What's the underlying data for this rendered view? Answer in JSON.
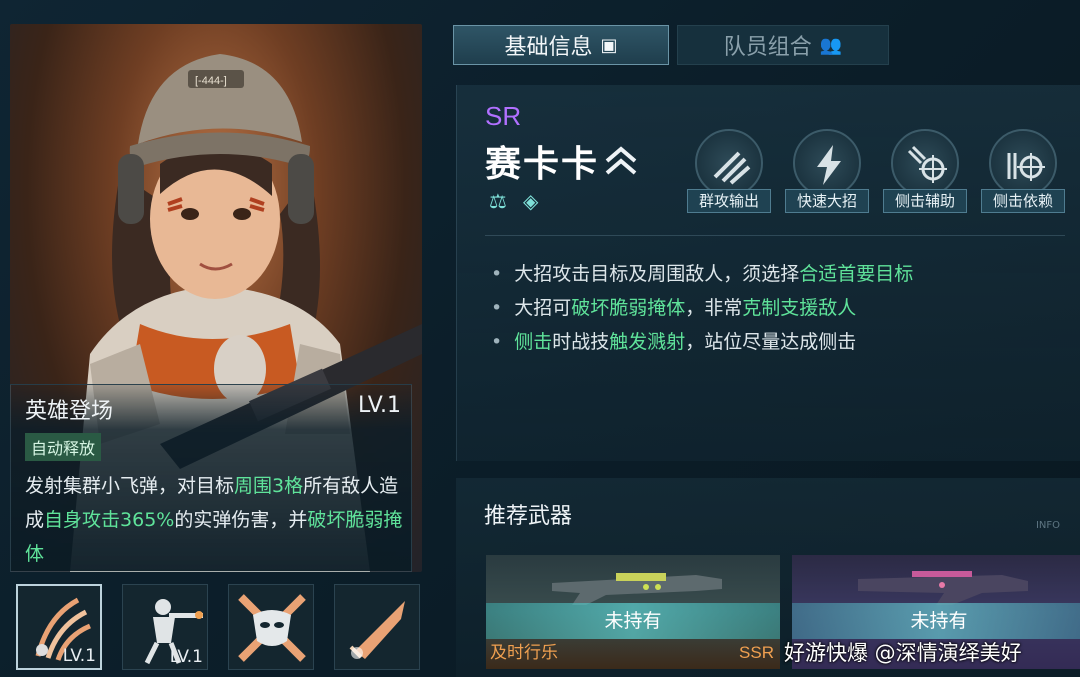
{
  "tabs": [
    {
      "label": "基础信息",
      "icon": "hero-card-icon",
      "active": true
    },
    {
      "label": "队员组合",
      "icon": "team-icon",
      "active": false
    }
  ],
  "hero": {
    "rarity": "SR",
    "name": "赛卡卡",
    "class_icons": [
      "balance-icon",
      "gem-icon"
    ],
    "traits": [
      {
        "label": "群攻输出",
        "icon": "missiles-icon"
      },
      {
        "label": "快速大招",
        "icon": "lightning-icon"
      },
      {
        "label": "侧击辅助",
        "icon": "flank-support-icon"
      },
      {
        "label": "侧击依赖",
        "icon": "flank-reliance-icon"
      }
    ],
    "tips": [
      [
        {
          "t": "大招攻击目标及周围敌人，须选择"
        },
        {
          "t": "合适首要目标",
          "hl": true
        }
      ],
      [
        {
          "t": "大招可"
        },
        {
          "t": "破坏脆弱掩体",
          "hl": true
        },
        {
          "t": "，非常"
        },
        {
          "t": "克制支援敌人",
          "hl": true
        }
      ],
      [
        {
          "t": "侧击",
          "hl": true
        },
        {
          "t": "时战技"
        },
        {
          "t": "触发溅射",
          "hl": true
        },
        {
          "t": "，站位尽量达成侧击"
        }
      ]
    ]
  },
  "skill": {
    "name": "英雄登场",
    "level": "LV.1",
    "tag": "自动释放",
    "desc": [
      {
        "t": "发射集群小飞弹，对目标"
      },
      {
        "t": "周围3格",
        "hl": true
      },
      {
        "t": "所有敌人造成"
      },
      {
        "t": "自身攻击365%",
        "hl": true
      },
      {
        "t": "的实弹伤害，并"
      },
      {
        "t": "破坏脆弱掩体",
        "hl": true
      }
    ]
  },
  "skill_icons": [
    {
      "icon": "missile-claw-icon",
      "level": "LV.1",
      "active": true
    },
    {
      "icon": "soldier-aim-icon",
      "level": "LV.1",
      "active": false
    },
    {
      "icon": "mask-cross-icon",
      "level": "",
      "active": false
    },
    {
      "icon": "bullet-icon",
      "level": "",
      "active": false
    }
  ],
  "weapons": {
    "title": "推荐武器",
    "info_label": "INFO",
    "items": [
      {
        "status": "未持有",
        "name": "及时行乐",
        "rarity": "SSR"
      },
      {
        "status": "未持有",
        "name": "",
        "rarity": ""
      }
    ]
  },
  "watermark": "好游快爆 @深情演绎美好",
  "colors": {
    "highlight": "#5fe39a",
    "rarity_sr": "#b170ff",
    "weapon_text": "#f0a050"
  }
}
